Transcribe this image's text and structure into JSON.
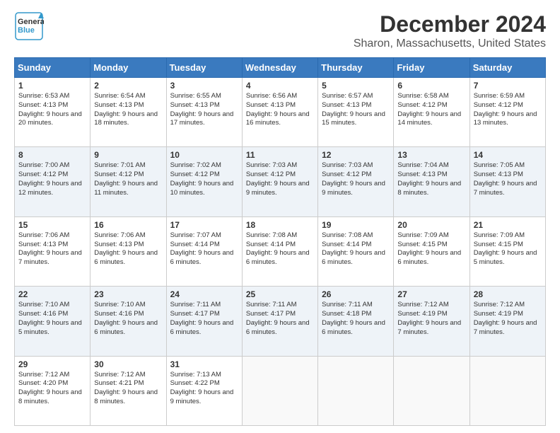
{
  "header": {
    "logo_general": "General",
    "logo_blue": "Blue",
    "month": "December 2024",
    "location": "Sharon, Massachusetts, United States"
  },
  "days_of_week": [
    "Sunday",
    "Monday",
    "Tuesday",
    "Wednesday",
    "Thursday",
    "Friday",
    "Saturday"
  ],
  "weeks": [
    [
      {
        "day": "1",
        "sunrise": "6:53 AM",
        "sunset": "4:13 PM",
        "daylight": "9 hours and 20 minutes."
      },
      {
        "day": "2",
        "sunrise": "6:54 AM",
        "sunset": "4:13 PM",
        "daylight": "9 hours and 18 minutes."
      },
      {
        "day": "3",
        "sunrise": "6:55 AM",
        "sunset": "4:13 PM",
        "daylight": "9 hours and 17 minutes."
      },
      {
        "day": "4",
        "sunrise": "6:56 AM",
        "sunset": "4:13 PM",
        "daylight": "9 hours and 16 minutes."
      },
      {
        "day": "5",
        "sunrise": "6:57 AM",
        "sunset": "4:13 PM",
        "daylight": "9 hours and 15 minutes."
      },
      {
        "day": "6",
        "sunrise": "6:58 AM",
        "sunset": "4:12 PM",
        "daylight": "9 hours and 14 minutes."
      },
      {
        "day": "7",
        "sunrise": "6:59 AM",
        "sunset": "4:12 PM",
        "daylight": "9 hours and 13 minutes."
      }
    ],
    [
      {
        "day": "8",
        "sunrise": "7:00 AM",
        "sunset": "4:12 PM",
        "daylight": "9 hours and 12 minutes."
      },
      {
        "day": "9",
        "sunrise": "7:01 AM",
        "sunset": "4:12 PM",
        "daylight": "9 hours and 11 minutes."
      },
      {
        "day": "10",
        "sunrise": "7:02 AM",
        "sunset": "4:12 PM",
        "daylight": "9 hours and 10 minutes."
      },
      {
        "day": "11",
        "sunrise": "7:03 AM",
        "sunset": "4:12 PM",
        "daylight": "9 hours and 9 minutes."
      },
      {
        "day": "12",
        "sunrise": "7:03 AM",
        "sunset": "4:12 PM",
        "daylight": "9 hours and 9 minutes."
      },
      {
        "day": "13",
        "sunrise": "7:04 AM",
        "sunset": "4:13 PM",
        "daylight": "9 hours and 8 minutes."
      },
      {
        "day": "14",
        "sunrise": "7:05 AM",
        "sunset": "4:13 PM",
        "daylight": "9 hours and 7 minutes."
      }
    ],
    [
      {
        "day": "15",
        "sunrise": "7:06 AM",
        "sunset": "4:13 PM",
        "daylight": "9 hours and 7 minutes."
      },
      {
        "day": "16",
        "sunrise": "7:06 AM",
        "sunset": "4:13 PM",
        "daylight": "9 hours and 6 minutes."
      },
      {
        "day": "17",
        "sunrise": "7:07 AM",
        "sunset": "4:14 PM",
        "daylight": "9 hours and 6 minutes."
      },
      {
        "day": "18",
        "sunrise": "7:08 AM",
        "sunset": "4:14 PM",
        "daylight": "9 hours and 6 minutes."
      },
      {
        "day": "19",
        "sunrise": "7:08 AM",
        "sunset": "4:14 PM",
        "daylight": "9 hours and 6 minutes."
      },
      {
        "day": "20",
        "sunrise": "7:09 AM",
        "sunset": "4:15 PM",
        "daylight": "9 hours and 6 minutes."
      },
      {
        "day": "21",
        "sunrise": "7:09 AM",
        "sunset": "4:15 PM",
        "daylight": "9 hours and 5 minutes."
      }
    ],
    [
      {
        "day": "22",
        "sunrise": "7:10 AM",
        "sunset": "4:16 PM",
        "daylight": "9 hours and 5 minutes."
      },
      {
        "day": "23",
        "sunrise": "7:10 AM",
        "sunset": "4:16 PM",
        "daylight": "9 hours and 6 minutes."
      },
      {
        "day": "24",
        "sunrise": "7:11 AM",
        "sunset": "4:17 PM",
        "daylight": "9 hours and 6 minutes."
      },
      {
        "day": "25",
        "sunrise": "7:11 AM",
        "sunset": "4:17 PM",
        "daylight": "9 hours and 6 minutes."
      },
      {
        "day": "26",
        "sunrise": "7:11 AM",
        "sunset": "4:18 PM",
        "daylight": "9 hours and 6 minutes."
      },
      {
        "day": "27",
        "sunrise": "7:12 AM",
        "sunset": "4:19 PM",
        "daylight": "9 hours and 7 minutes."
      },
      {
        "day": "28",
        "sunrise": "7:12 AM",
        "sunset": "4:19 PM",
        "daylight": "9 hours and 7 minutes."
      }
    ],
    [
      {
        "day": "29",
        "sunrise": "7:12 AM",
        "sunset": "4:20 PM",
        "daylight": "9 hours and 8 minutes."
      },
      {
        "day": "30",
        "sunrise": "7:12 AM",
        "sunset": "4:21 PM",
        "daylight": "9 hours and 8 minutes."
      },
      {
        "day": "31",
        "sunrise": "7:13 AM",
        "sunset": "4:22 PM",
        "daylight": "9 hours and 9 minutes."
      },
      null,
      null,
      null,
      null
    ]
  ]
}
